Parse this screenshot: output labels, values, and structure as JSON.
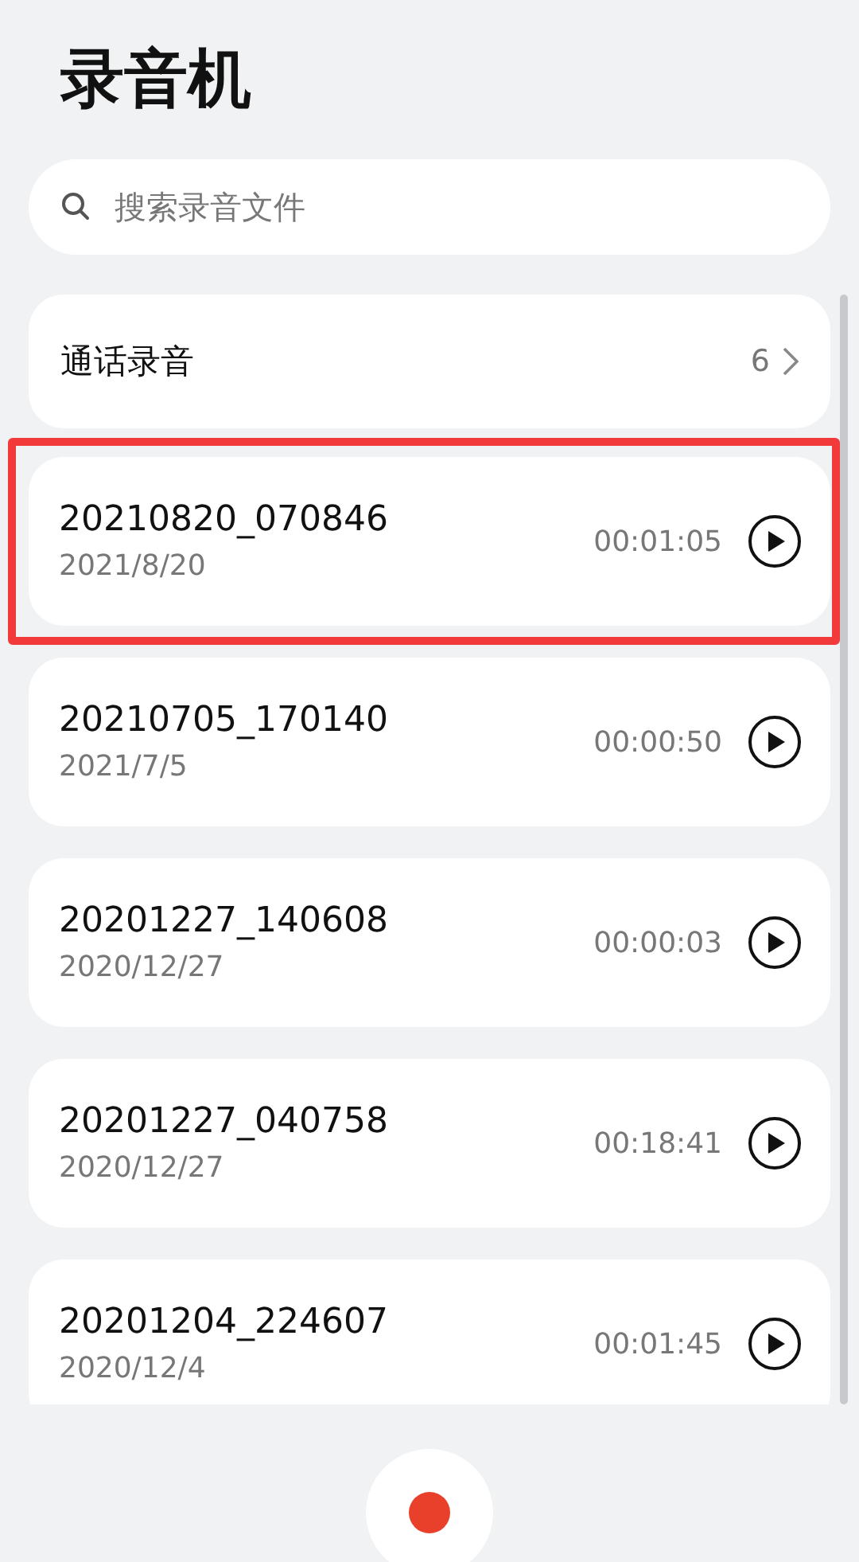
{
  "title": "录音机",
  "search": {
    "placeholder": "搜索录音文件"
  },
  "call_folder": {
    "label": "通话录音",
    "count": "6"
  },
  "recordings": [
    {
      "name": "20210820_070846",
      "date": "2021/8/20",
      "duration": "00:01:05",
      "selected": true
    },
    {
      "name": "20210705_170140",
      "date": "2021/7/5",
      "duration": "00:00:50",
      "selected": false
    },
    {
      "name": "20201227_140608",
      "date": "2020/12/27",
      "duration": "00:00:03",
      "selected": false
    },
    {
      "name": "20201227_040758",
      "date": "2020/12/27",
      "duration": "00:18:41",
      "selected": false
    },
    {
      "name": "20201204_224607",
      "date": "2020/12/4",
      "duration": "00:01:45",
      "selected": false
    }
  ]
}
